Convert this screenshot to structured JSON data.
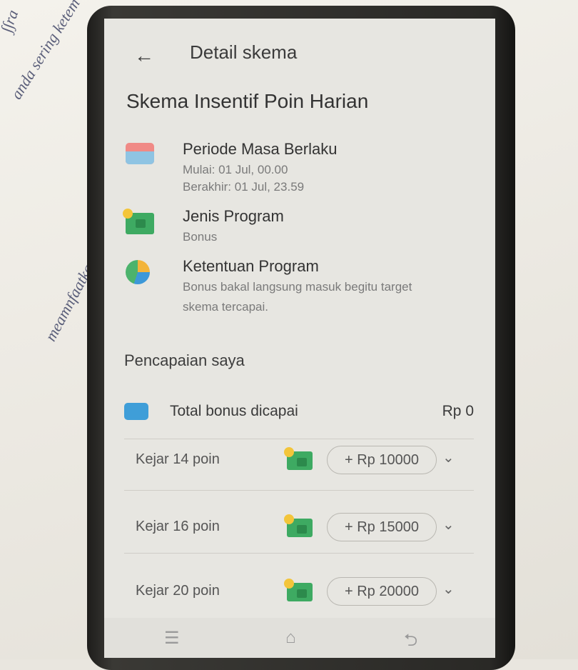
{
  "appbar": {
    "back_icon": "arrow-left-icon",
    "title": "Detail skema"
  },
  "scheme_title": "Skema Insentif Poin Harian",
  "info": [
    {
      "icon": "calendar-icon",
      "label": "Periode Masa Berlaku",
      "lines": [
        "Mulai: 01 Jul, 00.00",
        "Berakhir: 01 Jul, 23.59"
      ]
    },
    {
      "icon": "cash-icon",
      "label": "Jenis Program",
      "lines": [
        "Bonus"
      ]
    },
    {
      "icon": "rules-icon",
      "label": "Ketentuan Program",
      "lines": [
        "Bonus bakal langsung masuk begitu target",
        "skema tercapai."
      ]
    }
  ],
  "achievement": {
    "title": "Pencapaian saya",
    "total_label": "Total bonus dicapai",
    "total_value": "Rp 0"
  },
  "targets": [
    {
      "label": "Kejar 14 poin",
      "reward": "+ Rp 10000"
    },
    {
      "label": "Kejar 16 poin",
      "reward": "+ Rp 15000"
    },
    {
      "label": "Kejar 20 poin",
      "reward": "+ Rp 20000"
    }
  ],
  "navbar": {
    "icons": [
      "menu-icon",
      "home-icon",
      "back-nav-icon"
    ]
  }
}
